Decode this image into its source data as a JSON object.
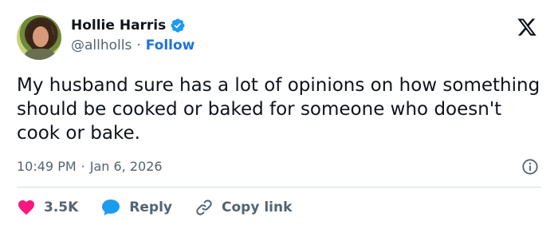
{
  "author": {
    "name": "Hollie Harris",
    "handle": "@allholls",
    "separator": "·",
    "follow_label": "Follow"
  },
  "tweet": {
    "text": "My husband sure has a lot of opinions on how something should be cooked or baked for someone who doesn't cook or bake.",
    "time": "10:49 PM",
    "meta_separator": "·",
    "date": "Jan 6, 2026"
  },
  "actions": {
    "likes": "3.5K",
    "reply_label": "Reply",
    "copy_label": "Copy link"
  },
  "colors": {
    "accent": "#1d9bf0",
    "like": "#f91880",
    "text": "#0f1419",
    "muted": "#536471"
  },
  "icons": [
    "verified-badge-icon",
    "x-logo-icon",
    "info-icon",
    "heart-icon",
    "reply-bubble-icon",
    "link-icon"
  ]
}
